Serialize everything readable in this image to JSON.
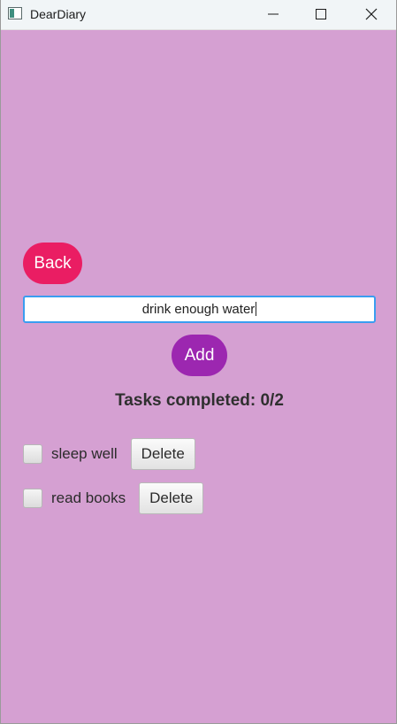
{
  "window": {
    "title": "DearDiary",
    "background": "#d5a0d2"
  },
  "titlebar_buttons": [
    "minimize-icon",
    "maximize-icon",
    "close-icon"
  ],
  "back_button": {
    "label": "Back",
    "color": "#ea1d63"
  },
  "task_input": {
    "value": "drink enough water"
  },
  "add_button": {
    "label": "Add",
    "color": "#9c27b0"
  },
  "progress": {
    "text": "Tasks completed: 0/2",
    "completed": 0,
    "total": 2
  },
  "tasks": [
    {
      "label": "sleep well",
      "checked": false,
      "delete_label": "Delete"
    },
    {
      "label": "read books",
      "checked": false,
      "delete_label": "Delete"
    }
  ]
}
